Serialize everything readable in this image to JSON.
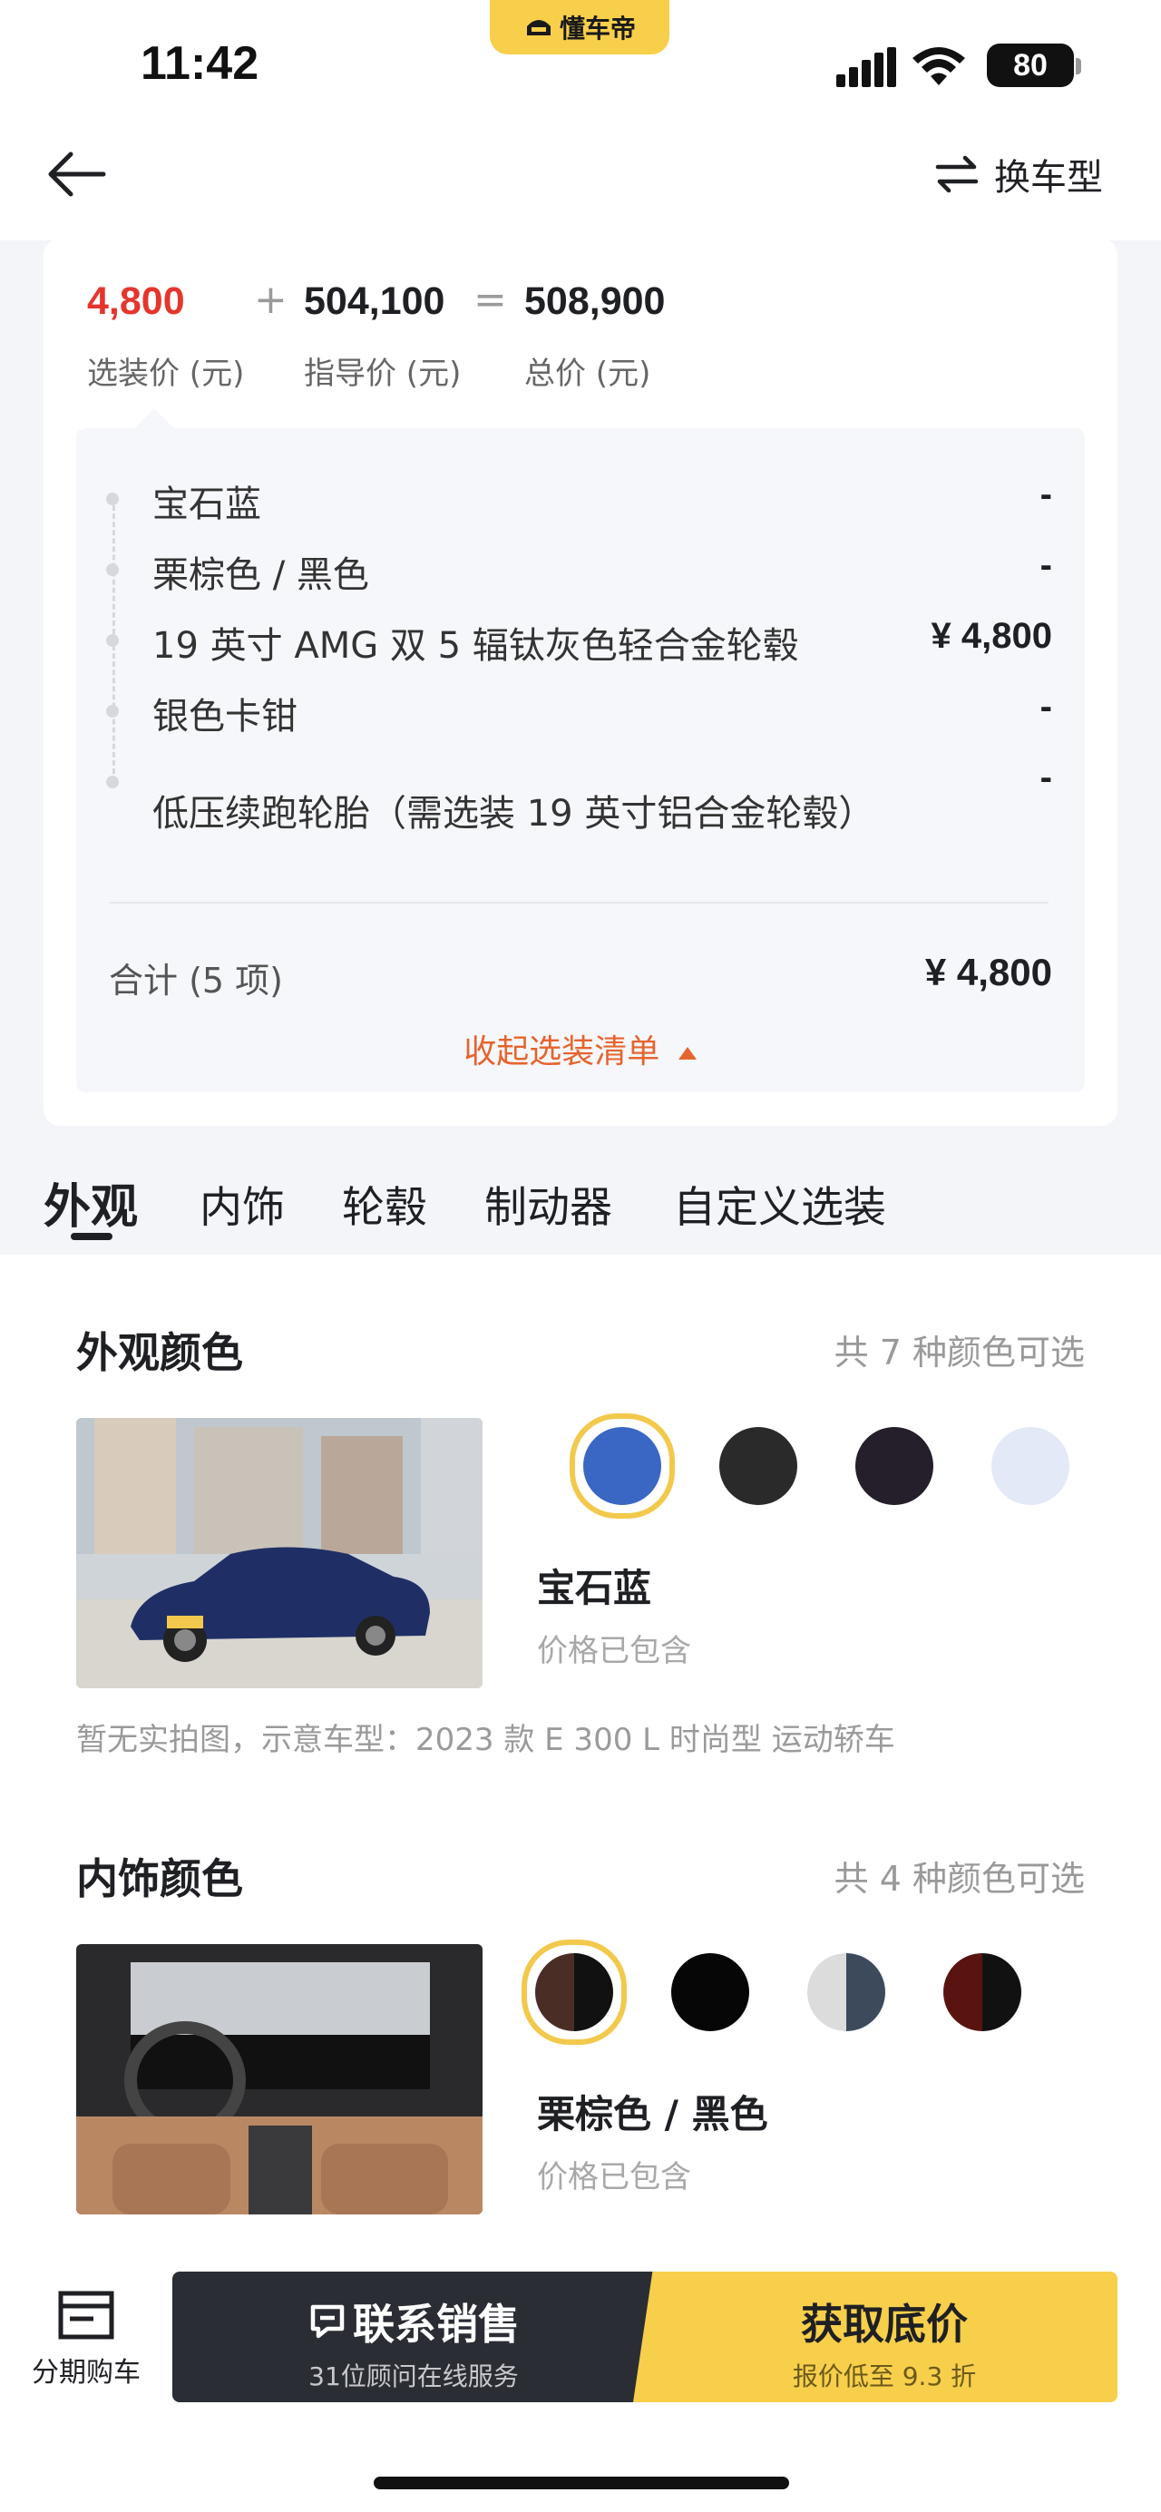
{
  "status_bar": {
    "time": "11:42",
    "app_badge": "懂车帝",
    "battery": "80"
  },
  "nav": {
    "switch_label": "换车型"
  },
  "price_summary": {
    "option_price": "4,800",
    "option_label": "选装价 (元)",
    "plus": "+",
    "guide_price": "504,100",
    "guide_label": "指导价 (元)",
    "equals": "=",
    "total_price": "508,900",
    "total_label": "总价 (元)"
  },
  "options": [
    {
      "name": "宝石蓝",
      "price": "-"
    },
    {
      "name": "栗棕色 / 黑色",
      "price": "-"
    },
    {
      "name": "19 英寸 AMG 双 5 辐钛灰色轻合金轮毂",
      "price": "¥ 4,800"
    },
    {
      "name": "银色卡钳",
      "price": "-"
    },
    {
      "name": "低压续跑轮胎（需选装 19 英寸铝合金轮毂）",
      "price": "-"
    }
  ],
  "options_total": {
    "label": "合计 (5 项)",
    "value": "¥ 4,800"
  },
  "collapse_label": "收起选装清单",
  "tabs": [
    "外观",
    "内饰",
    "轮毂",
    "制动器",
    "自定义选装"
  ],
  "exterior": {
    "title": "外观颜色",
    "count": "共 7 种颜色可选",
    "selected_name": "宝石蓝",
    "selected_price": "价格已包含",
    "note": "暂无实拍图，示意车型：2023 款 E 300 L 时尚型 运动轿车",
    "swatches": [
      "#3a66c4",
      "#2a2a2a",
      "#241f2a",
      "#e3e9f6"
    ]
  },
  "interior": {
    "title": "内饰颜色",
    "count": "共 4 种颜色可选",
    "selected_name": "栗棕色 / 黑色",
    "selected_price": "价格已包含"
  },
  "bottom": {
    "finance_label": "分期购车",
    "contact_label": "联系销售",
    "contact_sub": "31位顾问在线服务",
    "price_label": "获取底价",
    "price_sub": "报价低至 9.3 折"
  }
}
